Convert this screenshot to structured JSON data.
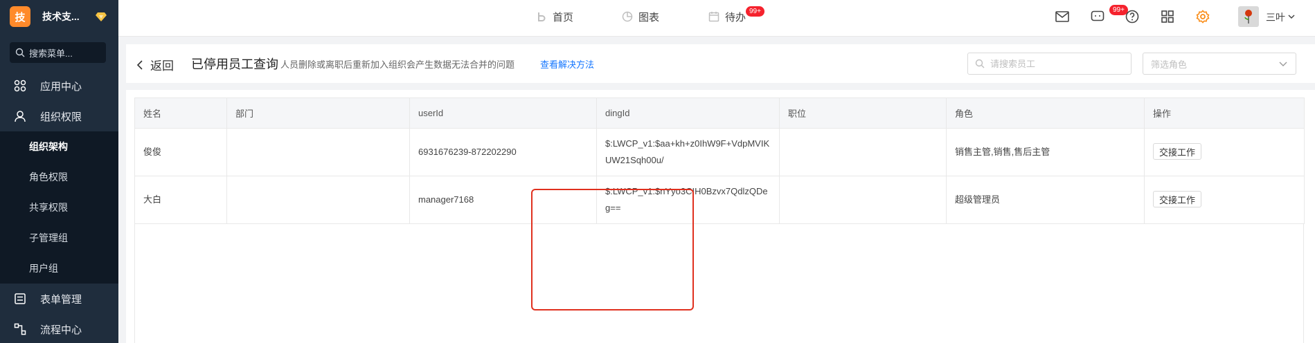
{
  "sidebar": {
    "brand_logo": "技",
    "brand_name": "技术支...",
    "search_placeholder": "搜索菜单...",
    "menu": [
      {
        "label": "应用中心"
      },
      {
        "label": "组织权限"
      }
    ],
    "submenu": [
      {
        "label": "组织架构"
      },
      {
        "label": "角色权限"
      },
      {
        "label": "共享权限"
      },
      {
        "label": "子管理组"
      },
      {
        "label": "用户组"
      }
    ],
    "menu_bottom": [
      {
        "label": "表单管理"
      },
      {
        "label": "流程中心"
      }
    ]
  },
  "topbar": {
    "nav": [
      {
        "label": "首页"
      },
      {
        "label": "图表"
      },
      {
        "label": "待办",
        "badge": "99+"
      }
    ],
    "message_badge": "99+",
    "user_name": "三叶"
  },
  "header": {
    "back_label": "返回",
    "title": "已停用员工查询",
    "description": "人员删除或离职后重新加入组织会产生数据无法合并的问题",
    "link_text": "查看解决方法",
    "search_placeholder": "请搜索员工",
    "role_placeholder": "筛选角色"
  },
  "table": {
    "columns": [
      "姓名",
      "部门",
      "userId",
      "dingId",
      "职位",
      "角色",
      "操作"
    ],
    "rows": [
      {
        "name": "俊俊",
        "dept": "",
        "userId": "6931676239-872202290",
        "dingId": "$:LWCP_v1:$aa+kh+z0IhW9F+VdpMVIKUW21Sqh00u/",
        "position": "",
        "role": "销售主管,销售,售后主管",
        "action": "交接工作"
      },
      {
        "name": "大白",
        "dept": "",
        "userId": "manager7168",
        "dingId": "$:LWCP_v1:$nYyo3CIH0Bzvx7QdlzQDeg==",
        "position": "",
        "role": "超级管理员",
        "action": "交接工作"
      }
    ]
  },
  "colors": {
    "sidebar_bg": "#1f2d3d",
    "brand_orange": "#ff8a2b",
    "link_blue": "#1677ff",
    "badge_red": "#f5222d",
    "highlight_red": "#e0301e"
  }
}
